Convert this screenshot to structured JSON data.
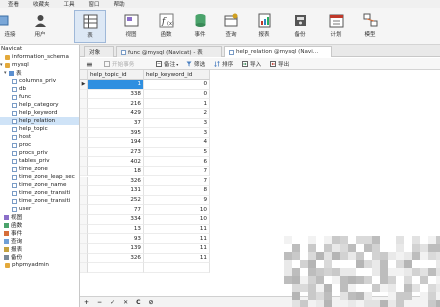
{
  "menubar": [
    "查看",
    "收藏夹",
    "工具",
    "窗口",
    "帮助"
  ],
  "toolbar": {
    "buttons": [
      {
        "label": "连接",
        "icon": "connect-icon"
      },
      {
        "label": "用户",
        "icon": "user-icon"
      },
      {
        "label": "表",
        "icon": "table-icon"
      },
      {
        "label": "视图",
        "icon": "view-icon"
      },
      {
        "label": "函数",
        "icon": "function-icon"
      },
      {
        "label": "事件",
        "icon": "event-icon"
      },
      {
        "label": "查询",
        "icon": "query-icon"
      },
      {
        "label": "报表",
        "icon": "report-icon"
      },
      {
        "label": "备份",
        "icon": "backup-icon"
      },
      {
        "label": "计划",
        "icon": "schedule-icon"
      },
      {
        "label": "模型",
        "icon": "model-icon"
      }
    ]
  },
  "nav": {
    "items": [
      {
        "label": "Navicat",
        "kind": "root"
      },
      {
        "label": "information_schema",
        "kind": "db"
      },
      {
        "label": "mysql",
        "kind": "db"
      },
      {
        "label": "表",
        "kind": "folder"
      },
      {
        "label": "columns_priv",
        "kind": "tbl"
      },
      {
        "label": "db",
        "kind": "tbl"
      },
      {
        "label": "func",
        "kind": "tbl"
      },
      {
        "label": "help_category",
        "kind": "tbl"
      },
      {
        "label": "help_keyword",
        "kind": "tbl"
      },
      {
        "label": "help_relation",
        "kind": "tbl",
        "selected": true
      },
      {
        "label": "help_topic",
        "kind": "tbl"
      },
      {
        "label": "host",
        "kind": "tbl"
      },
      {
        "label": "proc",
        "kind": "tbl"
      },
      {
        "label": "procs_priv",
        "kind": "tbl"
      },
      {
        "label": "tables_priv",
        "kind": "tbl"
      },
      {
        "label": "time_zone",
        "kind": "tbl"
      },
      {
        "label": "time_zone_leap_sec",
        "kind": "tbl"
      },
      {
        "label": "time_zone_name",
        "kind": "tbl"
      },
      {
        "label": "time_zone_transiti",
        "kind": "tbl"
      },
      {
        "label": "time_zone_transiti",
        "kind": "tbl"
      },
      {
        "label": "user",
        "kind": "tbl"
      },
      {
        "label": "视图",
        "kind": "view"
      },
      {
        "label": "函数",
        "kind": "func"
      },
      {
        "label": "事件",
        "kind": "evt"
      },
      {
        "label": "查询",
        "kind": "qry"
      },
      {
        "label": "报表",
        "kind": "rpt"
      },
      {
        "label": "备份",
        "kind": "bak"
      },
      {
        "label": "phpmyadmin",
        "kind": "db"
      }
    ]
  },
  "tabs": [
    {
      "label": "对象"
    },
    {
      "label": "func @mysql (Navicat) - 表"
    },
    {
      "label": "help_relation @mysql (Navi..."
    }
  ],
  "grid_toolbar": {
    "menu": "≡",
    "begin_tx": "开始事务",
    "memo": "备注",
    "filter": "筛选",
    "sort": "排序",
    "import": "导入",
    "export": "导出"
  },
  "grid": {
    "columns": [
      "help_topic_id",
      "help_keyword_id"
    ],
    "rows": [
      [
        "1",
        "0"
      ],
      [
        "338",
        "0"
      ],
      [
        "216",
        "1"
      ],
      [
        "429",
        "2"
      ],
      [
        "37",
        "3"
      ],
      [
        "395",
        "3"
      ],
      [
        "194",
        "4"
      ],
      [
        "273",
        "5"
      ],
      [
        "402",
        "6"
      ],
      [
        "18",
        "7"
      ],
      [
        "326",
        "7"
      ],
      [
        "131",
        "8"
      ],
      [
        "252",
        "9"
      ],
      [
        "77",
        "10"
      ],
      [
        "334",
        "10"
      ],
      [
        "13",
        "11"
      ],
      [
        "93",
        "11"
      ],
      [
        "139",
        "11"
      ],
      [
        "326",
        "11"
      ],
      [
        "",
        ""
      ]
    ],
    "current_row": 0
  },
  "bottom_bar": [
    "+",
    "−",
    "✓",
    "✕",
    "C",
    "⊘"
  ]
}
